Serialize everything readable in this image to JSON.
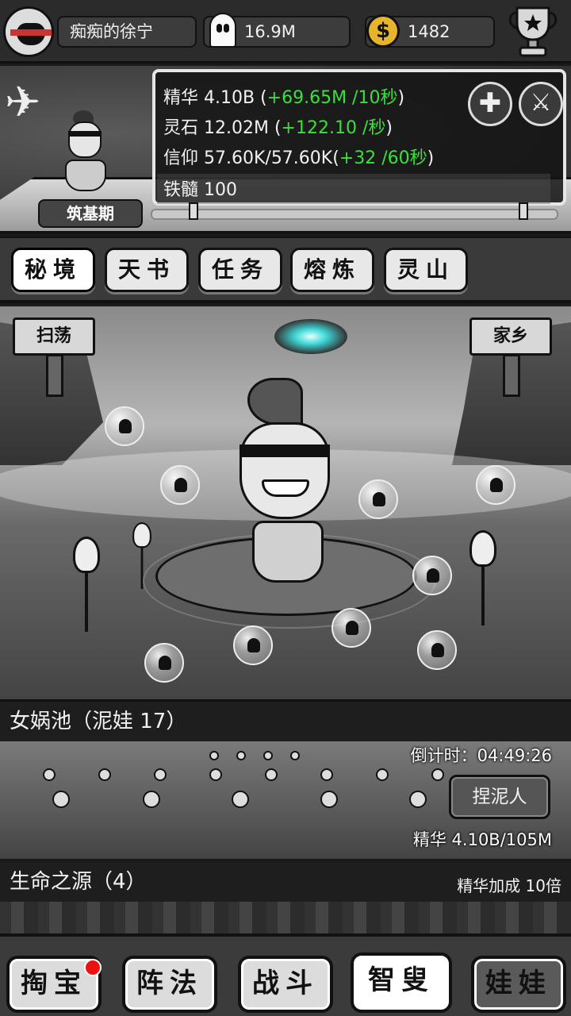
{
  "topbar": {
    "player_name": "痴痴的徐宁",
    "ghost_value": "16.9M",
    "coin_symbol": "$",
    "coin_value": "1482"
  },
  "status": {
    "realm": "筑基期",
    "stats": [
      {
        "label": "精华 4.10B",
        "rate": "+69.65M /10秒"
      },
      {
        "label": "灵石 12.02M",
        "rate": "+122.10 /秒"
      },
      {
        "label": "信仰 57.60K/57.60K",
        "rate": "+32 /60秒"
      },
      {
        "label": "铁髓 100",
        "rate": ""
      }
    ],
    "plus_icon": "plus-icon",
    "sword_icon": "sword-icon"
  },
  "tabs": [
    {
      "label": "秘境",
      "active": true
    },
    {
      "label": "天书",
      "active": false
    },
    {
      "label": "任务",
      "active": false
    },
    {
      "label": "熔炼",
      "active": false
    },
    {
      "label": "灵山",
      "active": false
    }
  ],
  "scene": {
    "sweep_label": "扫荡",
    "home_label": "家乡"
  },
  "pool": {
    "title": "女娲池（泥娃 17）",
    "countdown": "倒计时：04:49:26",
    "pinch_label": "捏泥人",
    "essence": "精华 4.10B/105M"
  },
  "life": {
    "title": "生命之源（4）",
    "bonus": "精华加成 10倍"
  },
  "bottom_nav": [
    {
      "label": "掏宝",
      "state": "normal",
      "badge": true
    },
    {
      "label": "阵法",
      "state": "normal",
      "badge": false
    },
    {
      "label": "战斗",
      "state": "normal",
      "badge": false
    },
    {
      "label": "智叟",
      "state": "active",
      "badge": false
    },
    {
      "label": "娃娃",
      "state": "dim",
      "badge": false
    }
  ],
  "colors": {
    "rate_green": "#3be03b",
    "badge_red": "#ee1111",
    "coin_gold": "#e7b52c",
    "vortex_cyan": "#40d8d8"
  }
}
